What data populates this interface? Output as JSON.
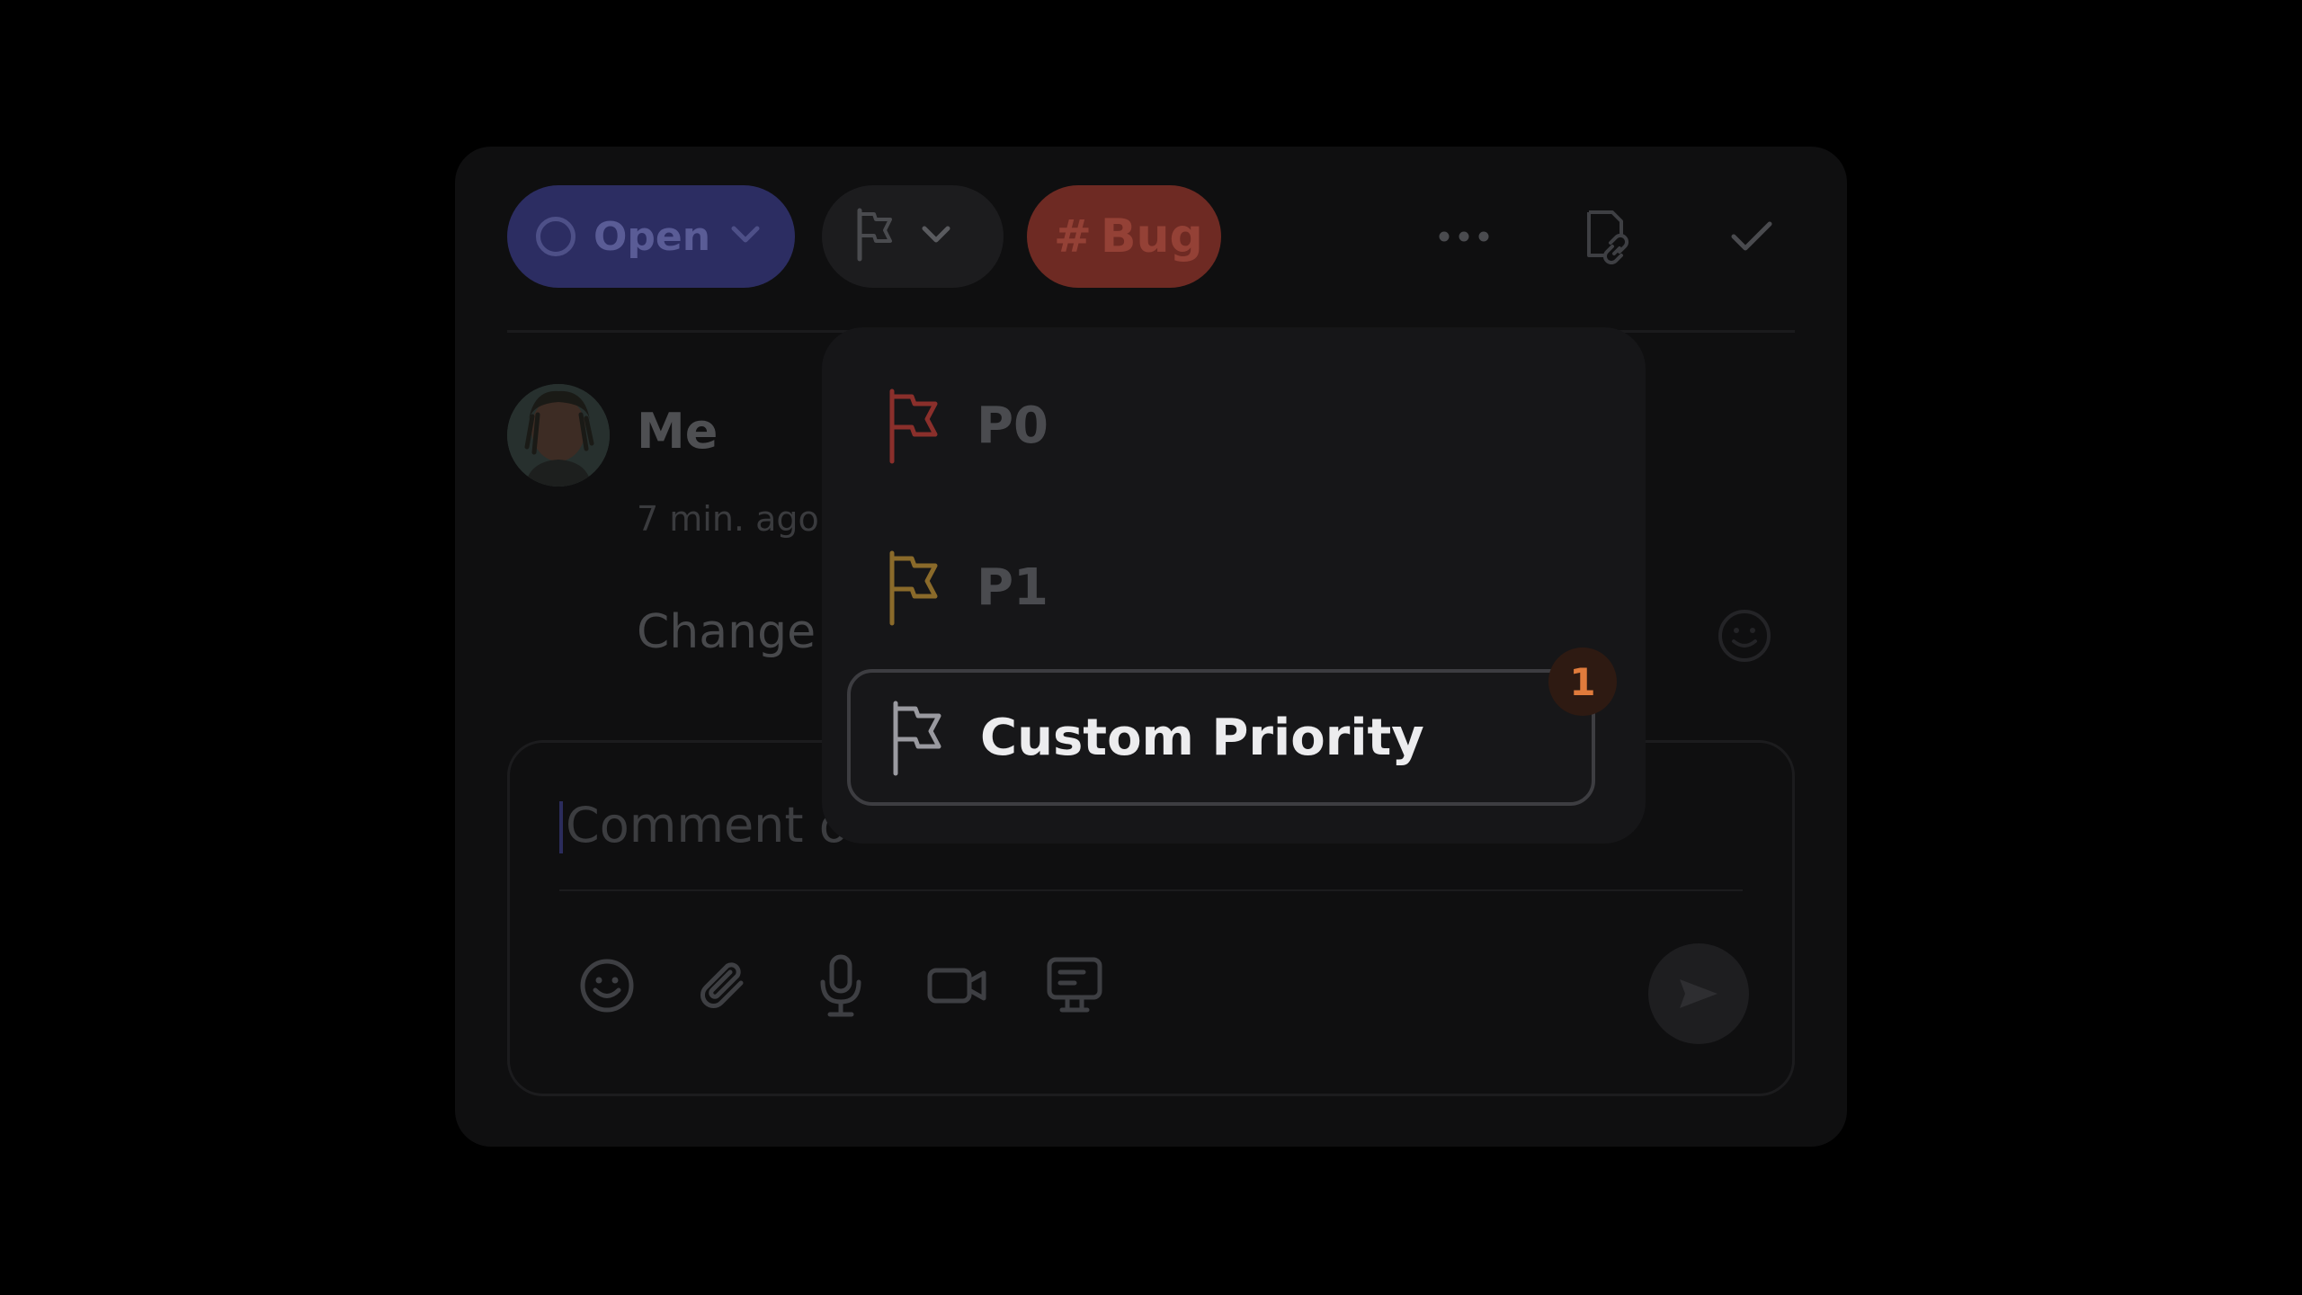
{
  "toolbar": {
    "status_label": "Open",
    "tag_hash": "#",
    "tag_label": "Bug",
    "icons": [
      "more-icon",
      "copy-link-icon",
      "check-icon"
    ],
    "status_color": "#2c2d62",
    "tag_color": "#6e2a23"
  },
  "comment": {
    "author": "Me",
    "time": "7 min. ago",
    "text": "Change"
  },
  "composer": {
    "placeholder": "Comment o",
    "tools": [
      "emoji-icon",
      "attachment-icon",
      "microphone-icon",
      "video-icon",
      "screen-record-icon",
      "send-icon"
    ]
  },
  "priority_menu": {
    "items": [
      {
        "label": "P0",
        "flag_color": "#8a2f2b",
        "selected": false
      },
      {
        "label": "P1",
        "flag_color": "#8a6a2a",
        "selected": false
      },
      {
        "label": "Custom Priority",
        "flag_color": "#9a9aa0",
        "selected": true
      }
    ],
    "badge": "1",
    "badge_color": "#e07b3c"
  }
}
